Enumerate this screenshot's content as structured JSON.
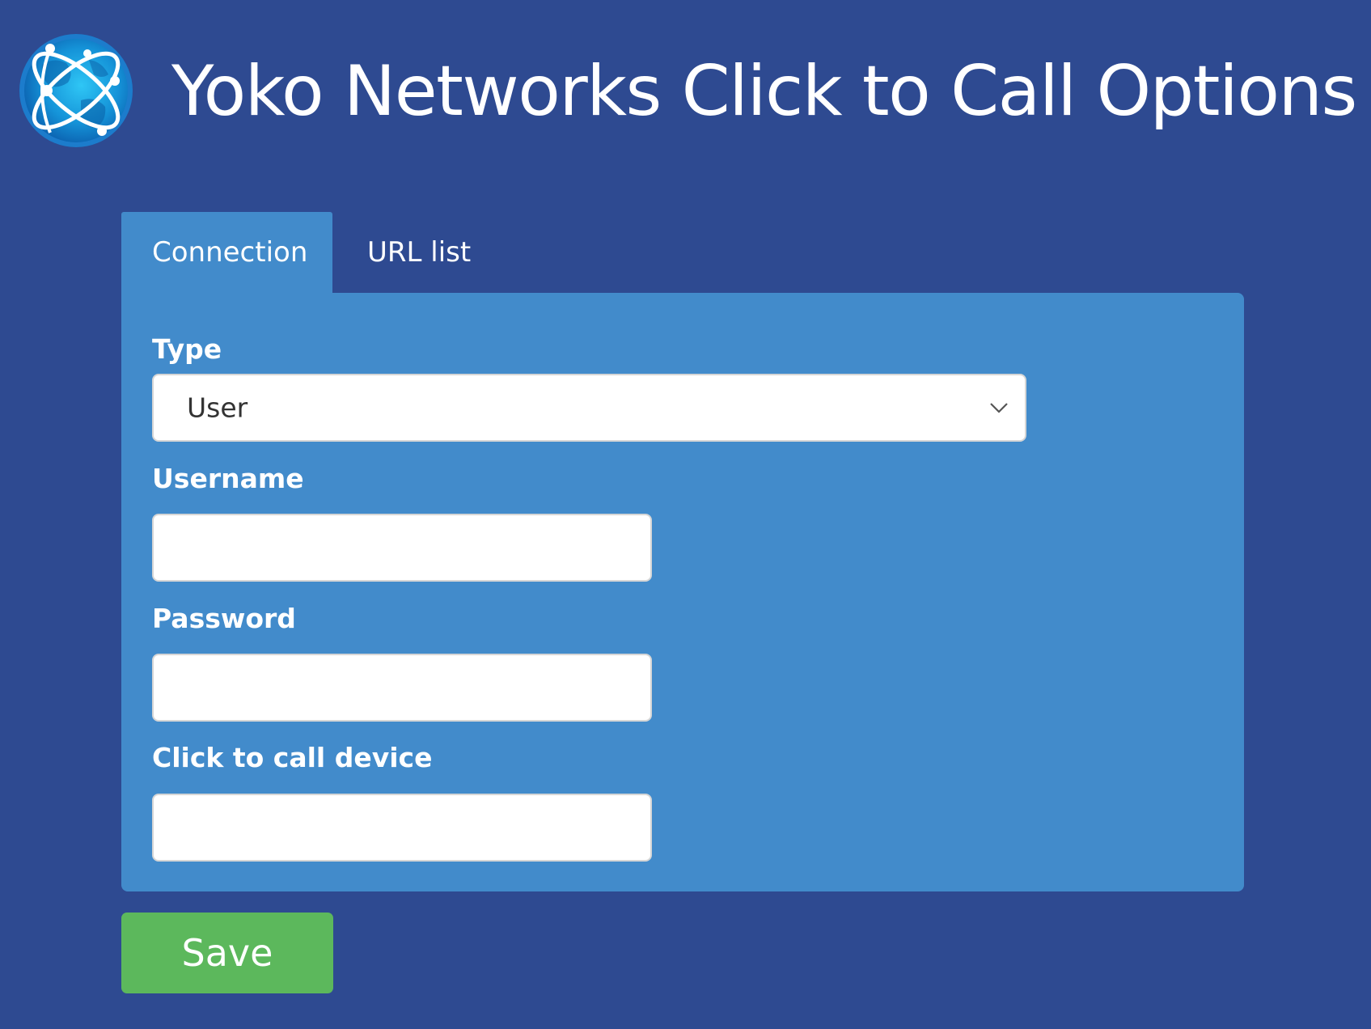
{
  "app": {
    "title": "Yoko Networks Click to Call Options",
    "logo_icon": "globe-network-icon"
  },
  "tabs": [
    {
      "label": "Connection",
      "active": true
    },
    {
      "label": "URL list",
      "active": false
    }
  ],
  "form": {
    "type": {
      "label": "Type",
      "selected": "User",
      "icon": "chevron-down-icon"
    },
    "username": {
      "label": "Username",
      "value": ""
    },
    "password": {
      "label": "Password",
      "value": ""
    },
    "device": {
      "label": "Click to call device",
      "value": ""
    }
  },
  "actions": {
    "save_label": "Save"
  },
  "colors": {
    "page_background": "#2e4a91",
    "panel_background": "#428bcb",
    "save_button": "#5cb85c",
    "input_background": "#ffffff"
  }
}
